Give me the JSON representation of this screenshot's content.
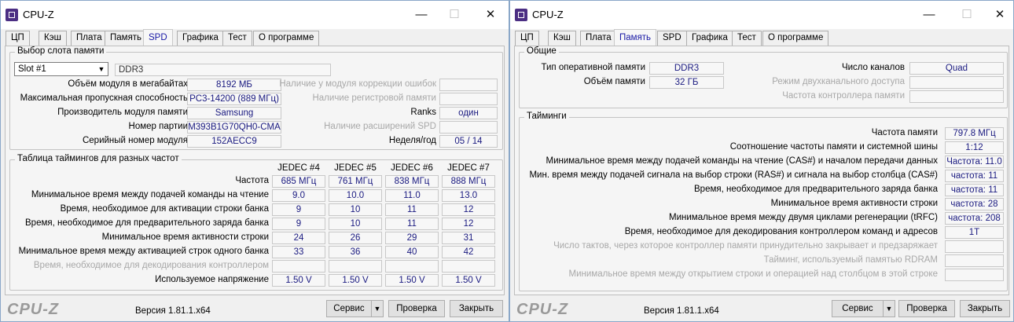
{
  "left": {
    "title": "CPU-Z",
    "window_controls": {
      "minimize": "—",
      "maximize": "☐",
      "close": "✕"
    },
    "tabs": [
      "ЦП",
      "Кэш",
      "Плата",
      "Память",
      "SPD",
      "Графика",
      "Тест",
      "О программе"
    ],
    "slot_group": {
      "title": "Выбор слота памяти",
      "slot_value": "Slot #1",
      "type_value": "DDR3",
      "rows": [
        {
          "label": "Объём модуля в мегабайтах",
          "value": "8192 МБ",
          "rlabel": "Наличие у модуля коррекции ошибок",
          "rvalue": ""
        },
        {
          "label": "Максимальная пропускная способность",
          "value": "PC3-14200 (889 МГц)",
          "rlabel": "Наличие регистровой памяти",
          "rvalue": ""
        },
        {
          "label": "Производитель модуля памяти",
          "value": "Samsung",
          "rlabel": "Ranks",
          "rvalue": "один"
        },
        {
          "label": "Номер партии",
          "value": "M393B1G70QH0-CMA",
          "rlabel": "Наличие расширений SPD",
          "rvalue": ""
        },
        {
          "label": "Серийный номер модуля",
          "value": "152AECC9",
          "rlabel": "Неделя/год",
          "rvalue": "05 / 14"
        }
      ]
    },
    "timings_group": {
      "title": "Таблица таймингов для разных частот",
      "columns": [
        "JEDEC #4",
        "JEDEC #5",
        "JEDEC #6",
        "JEDEC #7"
      ],
      "rows": [
        {
          "label": "Частота",
          "values": [
            "685 МГц",
            "761 МГц",
            "838 МГц",
            "888 МГц"
          ]
        },
        {
          "label": "Минимальное время между подачей команды на чтение",
          "values": [
            "9.0",
            "10.0",
            "11.0",
            "13.0"
          ]
        },
        {
          "label": "Время, необходимое для активации строки банка",
          "values": [
            "9",
            "10",
            "11",
            "12"
          ]
        },
        {
          "label": "Время, необходимое для предварительного заряда банка",
          "values": [
            "9",
            "10",
            "11",
            "12"
          ]
        },
        {
          "label": "Минимальное время активности строки",
          "values": [
            "24",
            "26",
            "29",
            "31"
          ]
        },
        {
          "label": "Минимальное время между активацией строк одного банка",
          "values": [
            "33",
            "36",
            "40",
            "42"
          ]
        },
        {
          "label": "Время, необходимое для декодирования контроллером",
          "values": [
            "",
            "",
            "",
            ""
          ]
        },
        {
          "label": "Используемое напряжение",
          "values": [
            "1.50 V",
            "1.50 V",
            "1.50 V",
            "1.50 V"
          ]
        }
      ]
    },
    "footer": {
      "brand": "CPU-Z",
      "version": "Версия 1.81.1.x64",
      "service": "Сервис",
      "validate": "Проверка",
      "close": "Закрыть",
      "drop": "▼"
    }
  },
  "right": {
    "title": "CPU-Z",
    "window_controls": {
      "minimize": "—",
      "maximize": "☐",
      "close": "✕"
    },
    "tabs": [
      "ЦП",
      "Кэш",
      "Плата",
      "Память",
      "SPD",
      "Графика",
      "Тест",
      "О программе"
    ],
    "general_group": {
      "title": "Общие",
      "type_label": "Тип оперативной памяти",
      "type_value": "DDR3",
      "size_label": "Объём памяти",
      "size_value": "32 ГБ",
      "channels_label": "Число каналов",
      "channels_value": "Quad",
      "dual_label": "Режим двухканального доступа",
      "dual_value": "",
      "nb_label": "Частота контроллера памяти",
      "nb_value": ""
    },
    "timings_group": {
      "title": "Тайминги",
      "rows": [
        {
          "label": "Частота памяти",
          "value": "797.8 МГц"
        },
        {
          "label": "Соотношение частоты памяти и системной шины",
          "value": "1:12"
        },
        {
          "label": "Минимальное время между подачей команды на чтение (CAS#) и началом передачи данных",
          "value": "Частота: 11.0"
        },
        {
          "label": "Мин. время между подачей сигнала на выбор строки (RAS#) и сигнала на выбор столбца (CAS#)",
          "value": "частота: 11"
        },
        {
          "label": "Время, необходимое для предварительного заряда банка",
          "value": "частота: 11"
        },
        {
          "label": "Минимальное время активности строки",
          "value": "частота: 28"
        },
        {
          "label": "Минимальное время между двумя циклами регенерации (tRFC)",
          "value": "частота: 208"
        },
        {
          "label": "Время, необходимое для декодирования контроллером команд и адресов",
          "value": "1T"
        },
        {
          "label": "Число тактов, через которое контроллер памяти принудительно закрывает и предзаряжает",
          "value": ""
        },
        {
          "label": "Тайминг, используемый памятью RDRAM",
          "value": ""
        },
        {
          "label": "Минимальное время между открытием строки и операцией над столбцом в этой строке",
          "value": ""
        }
      ]
    },
    "footer": {
      "brand": "CPU-Z",
      "version": "Версия 1.81.1.x64",
      "service": "Сервис",
      "validate": "Проверка",
      "close": "Закрыть",
      "drop": "▼"
    }
  }
}
